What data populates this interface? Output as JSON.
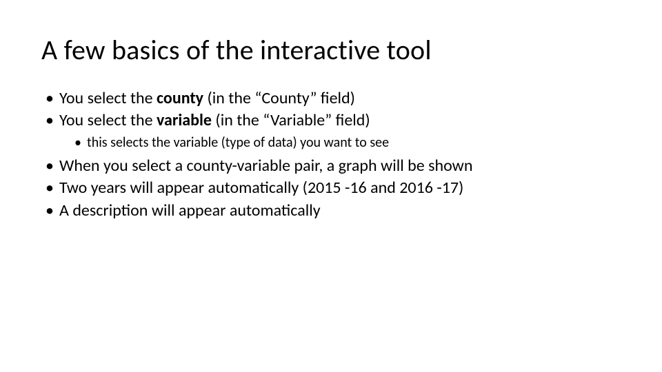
{
  "title": "A few basics of the interactive tool",
  "bullets": {
    "b1_pre": "You select the ",
    "b1_bold": "county",
    "b1_post": " (in the “County” field)",
    "b2_pre": "You select the ",
    "b2_bold": "variable",
    "b2_post": " (in the “Variable” field)",
    "b2_sub1": "this selects the variable (type of data) you want to see",
    "b3": "When you select a county-variable pair, a graph will be shown",
    "b4": "Two years will appear automatically (2015 -16 and 2016 -17)",
    "b5": "A description will appear automatically"
  }
}
